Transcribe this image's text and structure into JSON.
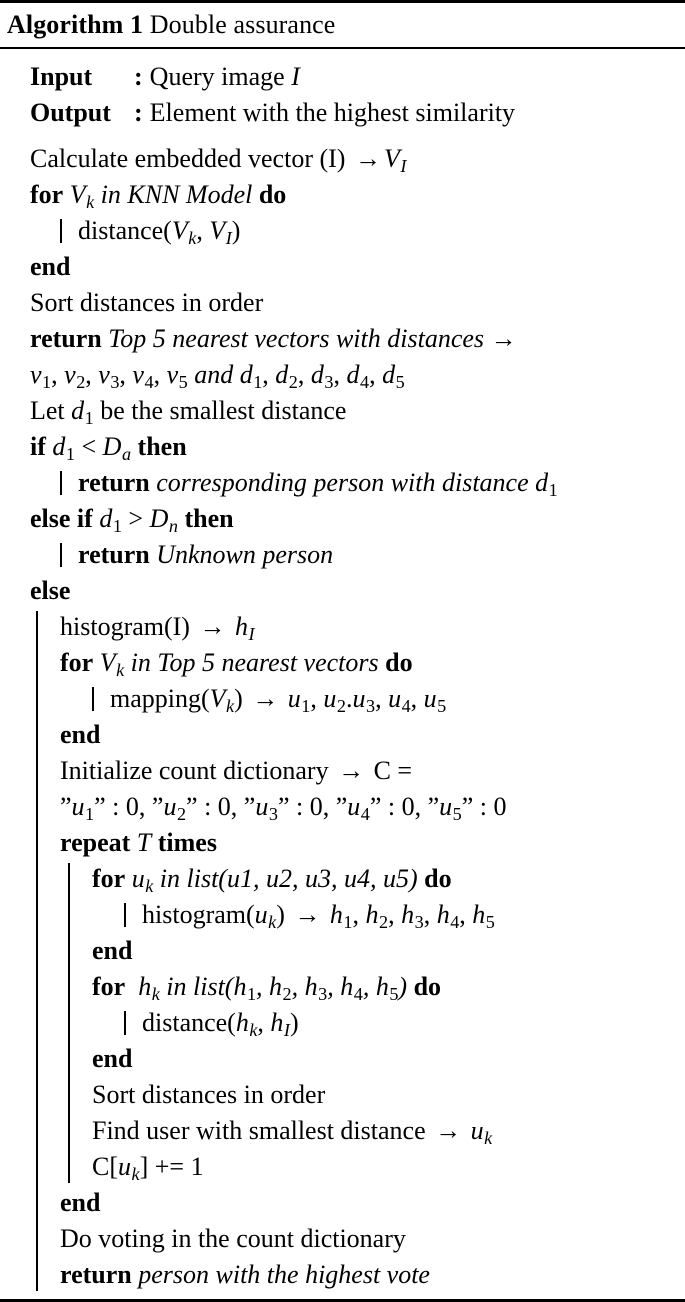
{
  "caption": {
    "number": "Algorithm 1",
    "title": "Double assurance"
  },
  "io": {
    "input_label": "Input",
    "input_sep": ":",
    "input_value": "Query image I",
    "output_label": "Output",
    "output_sep": ":",
    "output_value": "Element with the highest similarity"
  },
  "lines": {
    "l01": "Calculate embedded vector (I) → V",
    "l01_sub": "I",
    "l02_kw": "for",
    "l02_cond": "V",
    "l02_cond_sub": "k",
    "l02_cond2": " in KNN Model ",
    "l02_do": "do",
    "l03": "distance(V",
    "l03_sub": "k",
    "l03b": ", V",
    "l03_sub2": "I",
    "l03c": ")",
    "l04_end": "end",
    "l05": "Sort distances in order",
    "l06_kw": "return",
    "l06_txt": "Top 5 nearest vectors with distances →",
    "l07": "v1, v2, v3, v4, v5 and d1, d2, d3, d4, d5",
    "l08": "Let d1 be the smallest distance",
    "l09_kw": "if",
    "l09_cond": "d1 < Da",
    "l09_then": "then",
    "l10_kw": "return",
    "l10_txt": "corresponding person with distance d1",
    "l11_kw": "else if",
    "l11_cond": "d1 > Dn",
    "l11_then": "then",
    "l12_kw": "return",
    "l12_txt": "Unknown person",
    "l13_else": "else",
    "l14": "histogram(I) → hI",
    "l15_kw": "for",
    "l15_cond": "Vk in Top 5 nearest vectors",
    "l15_do": "do",
    "l16": "mapping(Vk) → u1, u2.u3, u4, u5",
    "l17_end": "end",
    "l18": "Initialize count dictionary → C =",
    "l19": "\"u1\" : 0, \"u2\" : 0, \"u3\" : 0, \"u4\" : 0, \"u5\" : 0",
    "l20_kw": "repeat",
    "l20_var": "T",
    "l20_times": "times",
    "l21_kw": "for",
    "l21_cond": "uk in list(u1, u2, u3, u4, u5)",
    "l21_do": "do",
    "l22": "histogram(uk) → h1, h2, h3, h4, h5",
    "l23_end": "end",
    "l24_kw": "for",
    "l24_cond": "hk in list(h1, h2, h3, h4, h5)",
    "l24_do": "do",
    "l25": "distance(hk, hI)",
    "l26_end": "end",
    "l27": "Sort distances in order",
    "l28": "Find user with smallest distance → uk",
    "l29": "C[uk] += 1",
    "l30_end": "end",
    "l31": "Do voting in the count dictionary",
    "l32_kw": "return",
    "l32_txt": "person with the highest vote"
  }
}
